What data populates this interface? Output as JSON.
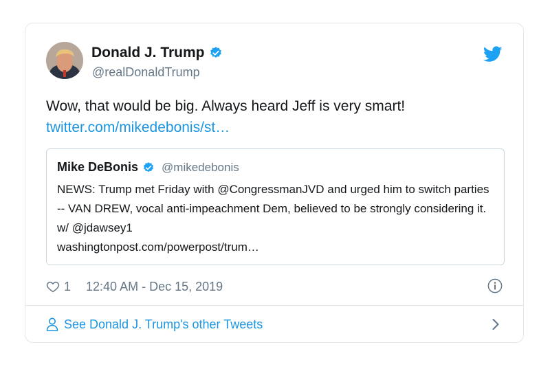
{
  "author": {
    "name": "Donald J. Trump",
    "handle": "@realDonaldTrump"
  },
  "tweet": {
    "text": "Wow, that would be big. Always heard Jeff is very smart!",
    "link": "twitter.com/mikedebonis/st…"
  },
  "quoted_tweet": {
    "name": "Mike DeBonis",
    "handle": "@mikedebonis",
    "text": "NEWS: Trump met Friday with @CongressmanJVD and urged him to switch parties -- VAN DREW, vocal anti-impeachment Dem, believed to be strongly considering it. w/ @jdawsey1",
    "link": "washingtonpost.com/powerpost/trum…"
  },
  "meta": {
    "like_count": "1",
    "timestamp": "12:40 AM - Dec 15, 2019"
  },
  "footer": {
    "label": "See Donald J. Trump's other Tweets"
  },
  "icons": {
    "verified": "verified-badge-icon",
    "bird": "twitter-bird-icon",
    "heart": "heart-icon",
    "info": "info-icon",
    "person": "person-icon",
    "chevron": "chevron-right-icon"
  },
  "colors": {
    "accent": "#1b95e0",
    "verified": "#1da1f2",
    "muted": "#657786",
    "border": "#e1e8ed"
  }
}
